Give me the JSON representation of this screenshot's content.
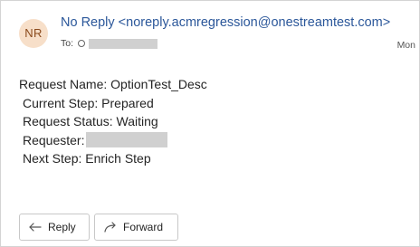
{
  "avatar": {
    "initials": "NR",
    "bg_color": "#f7dfc9",
    "fg_color": "#8a4a1c"
  },
  "header": {
    "sender": "No Reply <noreply.acmregression@onestreamtest.com>",
    "to_label": "To:",
    "date_partial": "Mon"
  },
  "body": {
    "request_name": "Request Name: OptionTest_Desc",
    "current_step": "Current Step: Prepared",
    "request_status": "Request Status: Waiting",
    "requester_label": "Requester:",
    "next_step": "Next Step: Enrich Step"
  },
  "actions": {
    "reply_label": "Reply",
    "reply_icon": "reply-arrow-icon",
    "forward_label": "Forward",
    "forward_icon": "forward-arrow-icon"
  },
  "colors": {
    "sender_link": "#2b579a",
    "border": "#c8c8c8"
  }
}
